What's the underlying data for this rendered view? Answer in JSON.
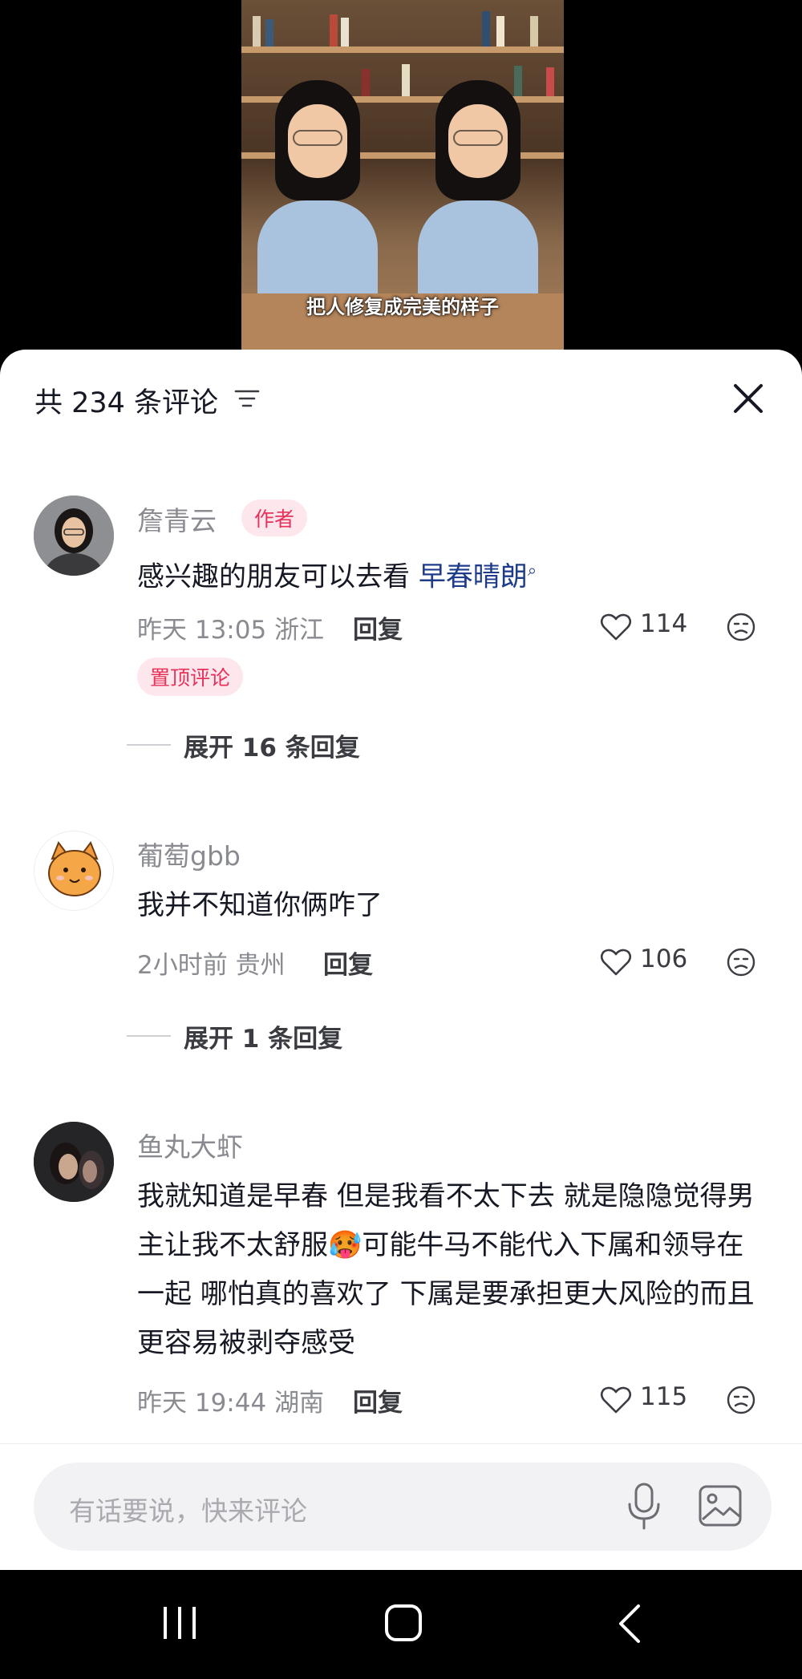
{
  "video": {
    "caption": "把人修复成完美的样子"
  },
  "comments_panel": {
    "title": "共 234 条评论",
    "filter_icon": "filter-icon",
    "close_icon": "close-icon"
  },
  "comments": [
    {
      "username": "詹青云",
      "badge": "作者",
      "text_before_link": "感兴趣的朋友可以去看 ",
      "link": "早春晴朗",
      "time": "昨天 13:05",
      "location": "浙江",
      "reply_label": "回复",
      "likes": "114",
      "pin_label": "置顶评论",
      "expand_label": "展开 16 条回复"
    },
    {
      "username": "葡萄gbb",
      "text": "我并不知道你俩咋了",
      "time": "2小时前",
      "location": "贵州",
      "reply_label": "回复",
      "likes": "106",
      "expand_label": "展开 1 条回复"
    },
    {
      "username": "鱼丸大虾",
      "text_part1": "我就知道是早春 但是我看不太下去 就是隐隐觉得男主让我不太舒服",
      "text_part2": "可能牛马不能代入下属和领导在一起 哪怕真的喜欢了 下属是要承担更大风险的而且更容易被剥夺感受",
      "emoji": "🥵",
      "time": "昨天 19:44",
      "location": "湖南",
      "reply_label": "回复",
      "likes": "115"
    }
  ],
  "input": {
    "placeholder": "有话要说，快来评论",
    "mic_icon": "microphone-icon",
    "image_icon": "image-icon"
  },
  "navbar": {
    "icons": [
      "recent-apps-icon",
      "home-icon",
      "back-icon"
    ]
  },
  "colors": {
    "accent_red": "#e8315a",
    "link_blue": "#1f3c8a",
    "meta_gray": "#8a8b91",
    "text_dark": "#161823"
  }
}
